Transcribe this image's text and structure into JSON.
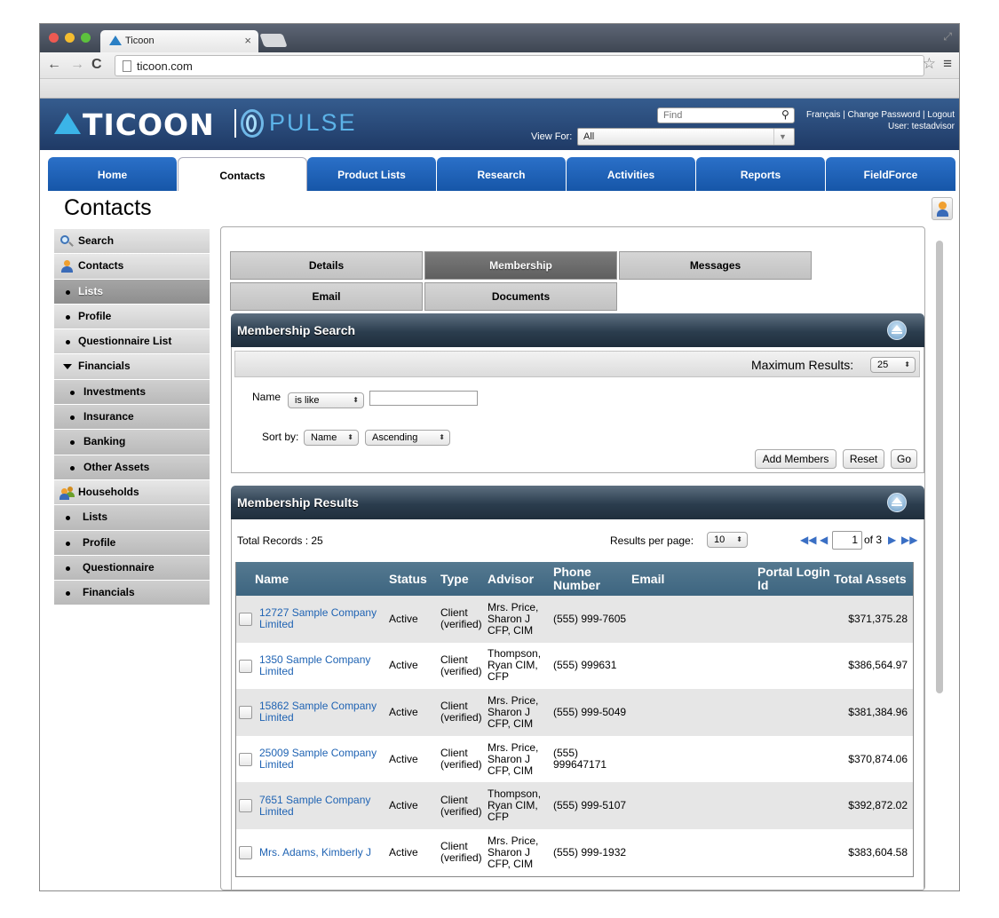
{
  "browser": {
    "tab_title": "Ticoon",
    "url": "ticoon.com"
  },
  "header": {
    "logo_text": "TICOON",
    "logo_product": "PULSE",
    "find_placeholder": "Find",
    "links": "Français | Change Password | Logout",
    "user_line": "User: testadvisor",
    "view_for_label": "View For:",
    "view_for_value": "All"
  },
  "main_tabs": [
    "Home",
    "Contacts",
    "Product Lists",
    "Research",
    "Activities",
    "Reports",
    "FieldForce"
  ],
  "active_main_tab": "Contacts",
  "page_title": "Contacts",
  "sidebar": {
    "items": [
      {
        "label": "Search",
        "icon": "search-icon",
        "style": "light"
      },
      {
        "label": "Contacts",
        "icon": "person-icon",
        "style": "light"
      },
      {
        "label": "Lists",
        "icon": "bullet",
        "style": "dark"
      },
      {
        "label": "Profile",
        "icon": "bullet",
        "style": "light"
      },
      {
        "label": "Questionnaire List",
        "icon": "bullet",
        "style": "light"
      },
      {
        "label": "Financials",
        "icon": "caret-down-icon",
        "style": "light"
      },
      {
        "label": "Investments",
        "icon": "bullet",
        "style": "mid"
      },
      {
        "label": "Insurance",
        "icon": "bullet",
        "style": "mid"
      },
      {
        "label": "Banking",
        "icon": "bullet",
        "style": "mid"
      },
      {
        "label": "Other Assets",
        "icon": "bullet",
        "style": "mid"
      },
      {
        "label": "Households",
        "icon": "group-icon",
        "style": "light"
      },
      {
        "label": "Lists",
        "icon": "bullet",
        "style": "mid"
      },
      {
        "label": "Profile",
        "icon": "bullet",
        "style": "mid"
      },
      {
        "label": "Questionnaire",
        "icon": "bullet",
        "style": "mid"
      },
      {
        "label": "Financials",
        "icon": "bullet",
        "style": "mid"
      }
    ]
  },
  "sub_tabs": {
    "details": "Details",
    "membership": "Membership",
    "messages": "Messages",
    "email": "Email",
    "documents": "Documents"
  },
  "membership_search": {
    "title": "Membership Search",
    "max_results_label": "Maximum Results:",
    "max_results_value": "25",
    "name_label": "Name",
    "name_operator": "is like",
    "name_value": "",
    "sort_label": "Sort by:",
    "sort_field": "Name",
    "sort_order": "Ascending",
    "add_members": "Add Members",
    "reset": "Reset",
    "go": "Go"
  },
  "membership_results": {
    "title": "Membership Results",
    "total_records": "Total Records : 25",
    "per_page_label": "Results per page:",
    "per_page_value": "10",
    "page_value": "1",
    "page_of": "of 3",
    "columns": [
      "Name",
      "Status",
      "Type",
      "Advisor",
      "Phone Number",
      "Email",
      "Portal Login Id",
      "Total Assets"
    ],
    "rows": [
      {
        "name": "12727 Sample Company Limited",
        "status": "Active",
        "type": "Client (verified)",
        "advisor": "Mrs. Price, Sharon J CFP, CIM",
        "phone": "(555) 999-7605",
        "email": "",
        "portal": "",
        "assets": "$371,375.28"
      },
      {
        "name": "1350 Sample Company Limited",
        "status": "Active",
        "type": "Client (verified)",
        "advisor": "Thompson, Ryan CIM, CFP",
        "phone": "(555) 999631",
        "email": "",
        "portal": "",
        "assets": "$386,564.97"
      },
      {
        "name": "15862 Sample Company Limited",
        "status": "Active",
        "type": "Client (verified)",
        "advisor": "Mrs. Price, Sharon J CFP, CIM",
        "phone": "(555) 999-5049",
        "email": "",
        "portal": "",
        "assets": "$381,384.96"
      },
      {
        "name": "25009 Sample Company Limited",
        "status": "Active",
        "type": "Client (verified)",
        "advisor": "Mrs. Price, Sharon J CFP, CIM",
        "phone": "(555) 999647171",
        "email": "",
        "portal": "",
        "assets": "$370,874.06"
      },
      {
        "name": "7651 Sample Company Limited",
        "status": "Active",
        "type": "Client (verified)",
        "advisor": "Thompson, Ryan CIM, CFP",
        "phone": "(555) 999-5107",
        "email": "",
        "portal": "",
        "assets": "$392,872.02"
      },
      {
        "name": "Mrs. Adams, Kimberly J",
        "status": "Active",
        "type": "Client (verified)",
        "advisor": "Mrs. Price, Sharon J CFP, CIM",
        "phone": "(555) 999-1932",
        "email": "",
        "portal": "",
        "assets": "$383,604.58"
      }
    ]
  }
}
